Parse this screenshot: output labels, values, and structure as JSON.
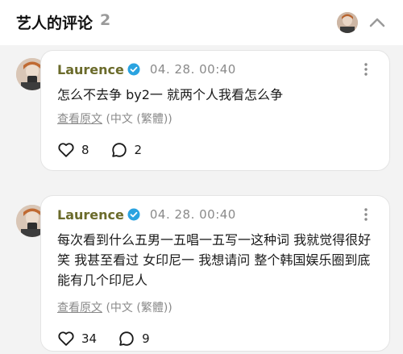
{
  "header": {
    "title": "艺人的评论",
    "count": "2",
    "avatar_icon": "avatar-thumbnail",
    "collapse_icon": "chevron-up-icon"
  },
  "comments": [
    {
      "author": "Laurence",
      "verified": true,
      "timestamp": "04. 28. 00:40",
      "text": "怎么不去争 by2一 就两个人我看怎么争",
      "translate_link": "查看原文",
      "translate_lang": "(中文 (繁體))",
      "likes": "8",
      "replies": "2"
    },
    {
      "author": "Laurence",
      "verified": true,
      "timestamp": "04. 28. 00:40",
      "text": "每次看到什么五男一五唱一五写一这种词 我就觉得很好笑 我甚至看过 女印尼一 我想请问 整个韩国娱乐圈到底能有几个印尼人",
      "translate_link": "查看原文",
      "translate_lang": "(中文 (繁體))",
      "likes": "34",
      "replies": "9"
    }
  ],
  "colors": {
    "background": "#f3f3f3",
    "card": "#ffffff",
    "author": "#6b6b2b",
    "verified": "#2aa3e0",
    "muted": "#8a8a8a"
  }
}
